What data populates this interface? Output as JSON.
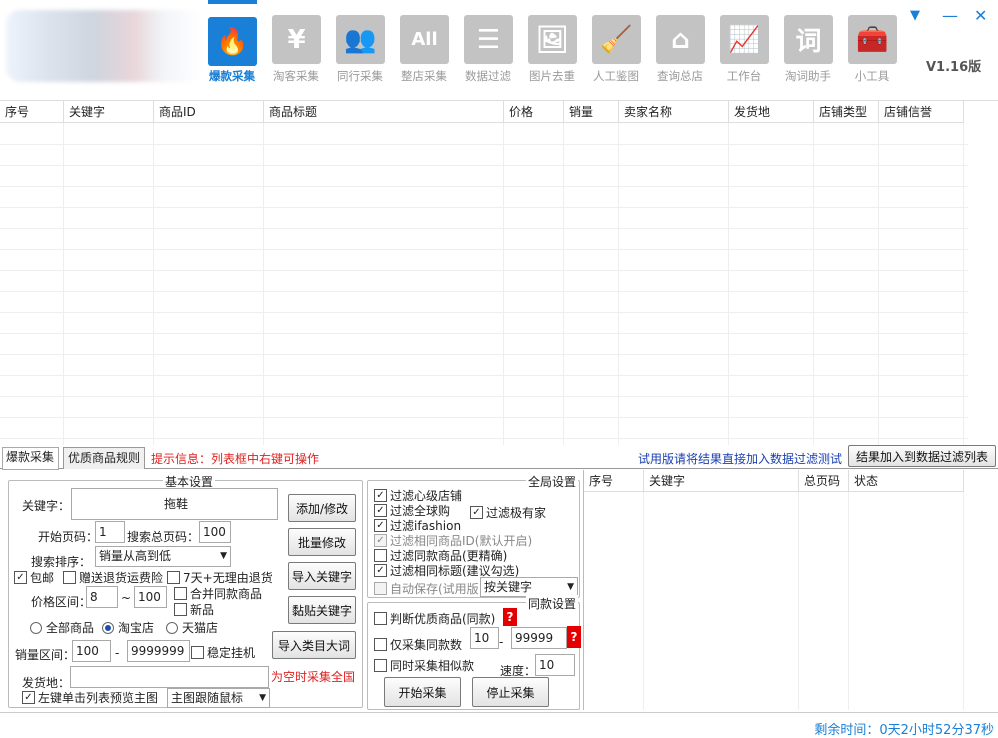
{
  "app": {
    "version": "V1.16版",
    "window_controls": {
      "menu": "▼",
      "minimize": "—",
      "close": "✕"
    }
  },
  "toolbar": [
    {
      "label": "爆款采集",
      "icon": "flame-icon",
      "glyph": "🔥",
      "active": true
    },
    {
      "label": "淘客采集",
      "icon": "yen-icon",
      "glyph": "¥"
    },
    {
      "label": "同行采集",
      "icon": "users-icon",
      "glyph": "👥"
    },
    {
      "label": "整店采集",
      "icon": "all-icon",
      "glyph": "All"
    },
    {
      "label": "数据过滤",
      "icon": "filter-icon",
      "glyph": "☰"
    },
    {
      "label": "图片去重",
      "icon": "image-icon",
      "glyph": "🖼"
    },
    {
      "label": "人工鉴图",
      "icon": "person-sweep-icon",
      "glyph": "🧹"
    },
    {
      "label": "查询总店",
      "icon": "house-icon",
      "glyph": "⌂"
    },
    {
      "label": "工作台",
      "icon": "chart-monitor-icon",
      "glyph": "📈"
    },
    {
      "label": "淘词助手",
      "icon": "word-icon",
      "glyph": "词"
    },
    {
      "label": "小工具",
      "icon": "toolbox-icon",
      "glyph": "🧰"
    }
  ],
  "grid": {
    "columns": [
      "序号",
      "关键字",
      "商品ID",
      "商品标题",
      "价格",
      "销量",
      "卖家名称",
      "发货地",
      "店铺类型",
      "店铺信誉"
    ]
  },
  "tabs": [
    "爆款采集",
    "优质商品规则"
  ],
  "hint": "提示信息：列表框中右键可操作",
  "trial_msg": "试用版请将结果直接加入数据过滤测试",
  "add_to_filter_button": "结果加入到数据过滤列表",
  "basic": {
    "title": "基本设置",
    "keyword_label": "关键字：",
    "keyword_value": "拖鞋",
    "start_page_label": "开始页码：",
    "start_page": "1",
    "total_pages_label": "搜索总页码：",
    "total_pages": "100",
    "sort_label": "搜索排序：",
    "sort_value": "销量从高到低",
    "free_ship": "包邮",
    "return_insurance": "赠送退货运费险",
    "seven_day": "7天+无理由退货",
    "merge_same": "合并同款商品",
    "new_item": "新品",
    "price_label": "价格区间：",
    "price_min": "8",
    "price_sep": "~",
    "price_max": "100",
    "radio_all": "全部商品",
    "radio_taobao": "淘宝店",
    "radio_tmall": "天猫店",
    "sales_label": "销量区间：",
    "sales_min": "100",
    "sales_sep": "-",
    "sales_max": "9999999",
    "stable_hang": "稳定挂机",
    "ship_label": "发货地：",
    "ship_note": "为空时采集全国",
    "preview_label": "左键单击列表预览主图",
    "preview_mode": "主图跟随鼠标"
  },
  "buttons": {
    "add_modify": "添加/修改",
    "batch_modify": "批量修改",
    "import_keywords": "导入关键字",
    "paste_keywords": "黏贴关键字",
    "import_category": "导入类目大词",
    "start": "开始采集",
    "stop": "停止采集"
  },
  "global": {
    "title": "全局设置",
    "filter_heart": "过滤心级店铺",
    "filter_global": "过滤全球购",
    "filter_jiyoujia": "过滤极有家",
    "filter_ifashion": "过滤ifashion",
    "filter_same_id": "过滤相同商品ID(默认开启)",
    "filter_same_item": "过滤同款商品(更精确)",
    "filter_same_title": "过滤相同标题(建议勾选)",
    "auto_save": "自动保存(试用版",
    "auto_save_mode": "按关键字"
  },
  "same": {
    "title": "同款设置",
    "judge_quality": "判断优质商品(同款)",
    "only_same_count": "仅采集同款数",
    "count_min": "10",
    "count_sep": "-",
    "count_max": "99999",
    "also_similar": "同时采集相似款",
    "speed_label": "速度：",
    "speed": "10",
    "help": "?"
  },
  "keyword_table": {
    "columns": [
      "序号",
      "关键字",
      "总页码",
      "状态"
    ]
  },
  "status": {
    "remaining": "剩余时间：0天2小时52分37秒"
  },
  "colors": {
    "accent": "#1a7fd6",
    "warn": "#e02020",
    "icon_gray": "#c3c3c3"
  }
}
